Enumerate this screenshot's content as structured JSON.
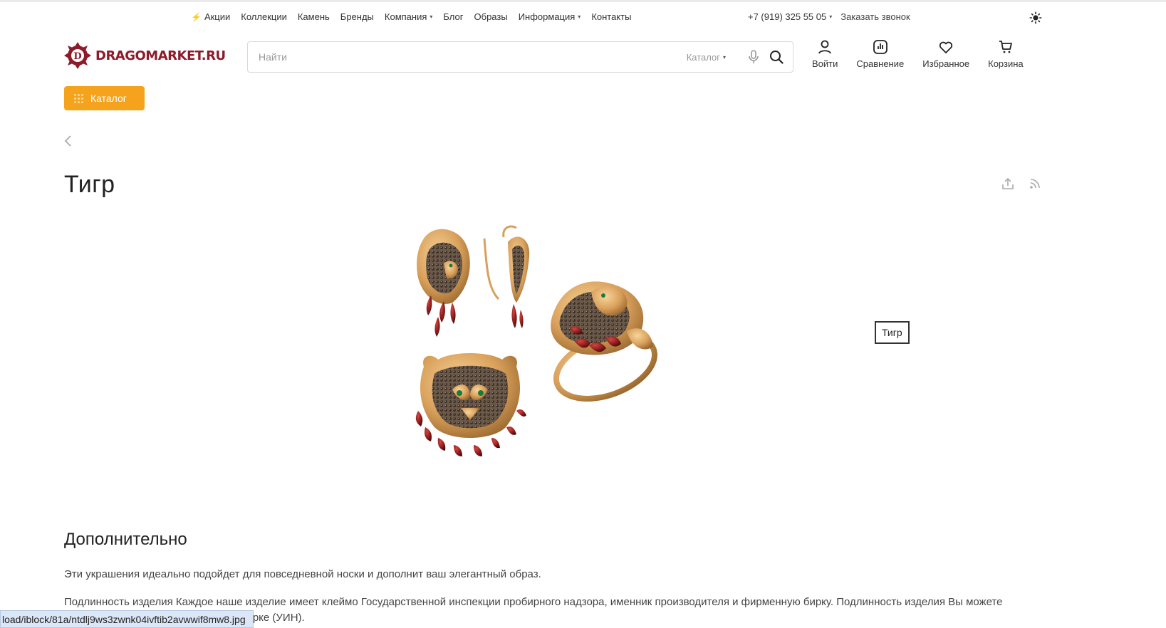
{
  "top_nav": {
    "items": [
      {
        "label": "Акции",
        "icon": "bolt-icon"
      },
      {
        "label": "Коллекции"
      },
      {
        "label": "Камень"
      },
      {
        "label": "Бренды"
      },
      {
        "label": "Компания",
        "dropdown": true
      },
      {
        "label": "Блог"
      },
      {
        "label": "Образы"
      },
      {
        "label": "Информация",
        "dropdown": true
      },
      {
        "label": "Контакты"
      }
    ],
    "phone": "+7 (919) 325 55 05",
    "callback_label": "Заказать звонок"
  },
  "header": {
    "logo_text": "DRAGOMARKET.RU",
    "search": {
      "placeholder": "Найти",
      "category_label": "Каталог"
    },
    "actions": [
      {
        "label": "Войти",
        "icon": "user-icon"
      },
      {
        "label": "Сравнение",
        "icon": "compare-icon"
      },
      {
        "label": "Избранное",
        "icon": "heart-icon"
      },
      {
        "label": "Корзина",
        "icon": "cart-icon"
      }
    ],
    "catalog_button": "Каталог"
  },
  "page": {
    "title": "Тигр",
    "image_tooltip": "Тигр",
    "section_title": "Дополнительно",
    "paragraph1": "Эти украшения идеально подойдет для повседневной носки и дополнит ваш элегантный образ.",
    "paragraph2": "Подлинность изделия Каждое наше изделие имеет клеймо Государственной инспекции пробирного надзора, именник производителя и фирменную бирку. Подлинность изделия Вы можете проверить по уникальному коду на бирке (УИН).",
    "status_url": "load/iblock/81a/ntdlj9ws3zwnk04ivftib2avwwif8mw8.jpg"
  },
  "colors": {
    "accent": "#f5a31d",
    "brand": "#8e1b2a",
    "gold": "#d9a05b",
    "garnet": "#8f1d1d"
  }
}
